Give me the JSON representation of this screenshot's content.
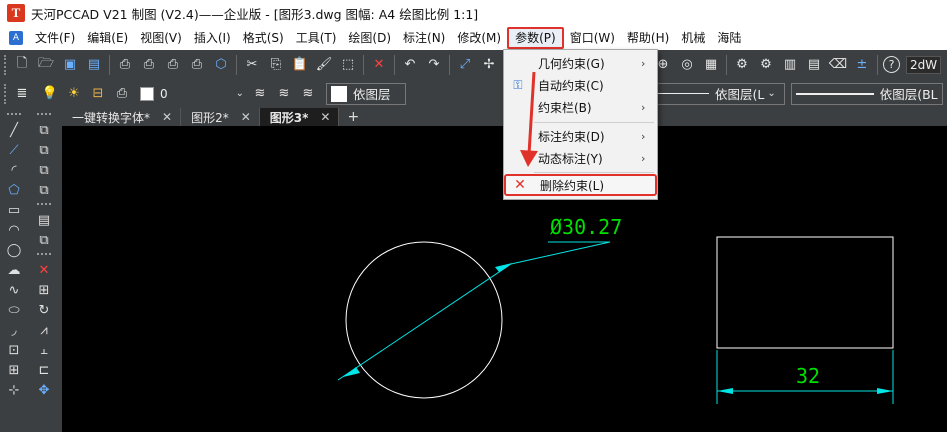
{
  "titlebar": {
    "logo_letter": "T",
    "title": "天河PCCAD V21 制图 (V2.4)——企业版 - [图形3.dwg 图幅: A4 绘图比例 1:1]"
  },
  "menubar": {
    "items": [
      {
        "label": "文件(F)"
      },
      {
        "label": "编辑(E)"
      },
      {
        "label": "视图(V)"
      },
      {
        "label": "插入(I)"
      },
      {
        "label": "格式(S)"
      },
      {
        "label": "工具(T)"
      },
      {
        "label": "绘图(D)"
      },
      {
        "label": "标注(N)"
      },
      {
        "label": "修改(M)"
      },
      {
        "label": "参数(P)"
      },
      {
        "label": "窗口(W)"
      },
      {
        "label": "帮助(H)"
      },
      {
        "label": "机械"
      },
      {
        "label": "海陆"
      }
    ],
    "active_index": 9
  },
  "toolbar2": {
    "layer_value": "0",
    "color_label": "依图层",
    "linetype_label": "依图层(L",
    "lineweight_label": "依图层(BL"
  },
  "toolbar1": {
    "view_mode": "2dW"
  },
  "tabs": [
    {
      "label": "一键转换字体*"
    },
    {
      "label": "图形2*"
    },
    {
      "label": "图形3*"
    }
  ],
  "active_tab": 2,
  "dropdown": {
    "items": [
      {
        "label": "几何约束(G)",
        "has_submenu": true
      },
      {
        "label": "自动约束(C)",
        "has_submenu": false
      },
      {
        "label": "约束栏(B)",
        "has_submenu": true
      },
      {
        "label": "标注约束(D)",
        "has_submenu": true
      },
      {
        "label": "动态标注(Y)",
        "has_submenu": true
      },
      {
        "label": "删除约束(L)",
        "has_submenu": false
      }
    ],
    "highlighted_index": 5
  },
  "drawing": {
    "diameter_label": "Ø30.27",
    "width_label": "32",
    "dimension_color": "#00e5e5",
    "text_color": "#00e000",
    "geometry_color": "#ffffff"
  },
  "colors": {
    "accent_red": "#e0322a",
    "toolbar_bg": "#3c3f41"
  }
}
